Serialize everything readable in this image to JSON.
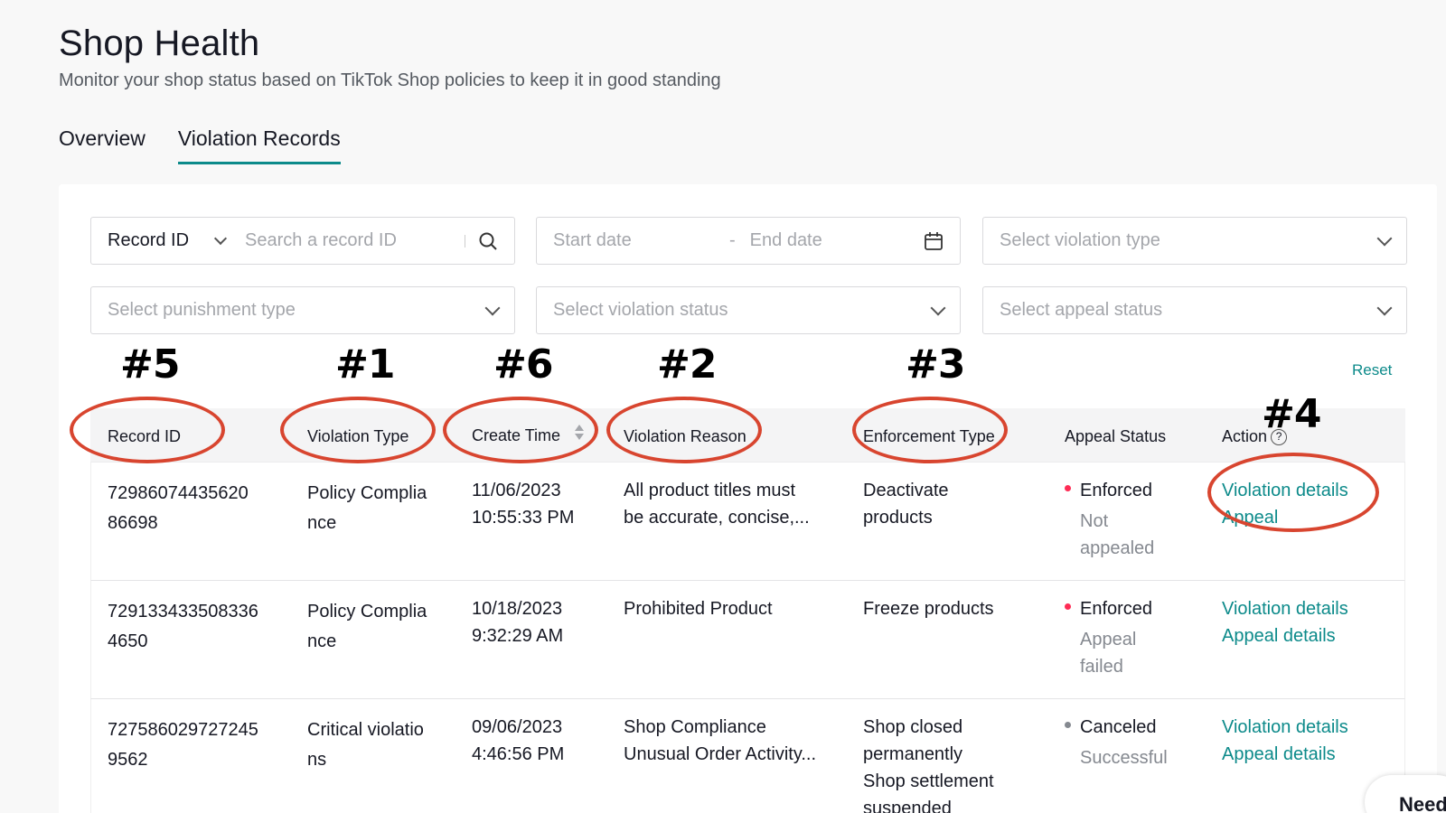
{
  "page": {
    "title": "Shop Health",
    "subtitle": "Monitor your shop status based on TikTok Shop policies to keep it in good standing"
  },
  "tabs": [
    {
      "label": "Overview",
      "active": false
    },
    {
      "label": "Violation Records",
      "active": true
    }
  ],
  "filters": {
    "record_select": "Record ID",
    "record_search_placeholder": "Search a record ID",
    "start_date_placeholder": "Start date",
    "date_separator": "-",
    "end_date_placeholder": "End date",
    "violation_type_placeholder": "Select violation type",
    "punishment_type_placeholder": "Select punishment type",
    "violation_status_placeholder": "Select violation status",
    "appeal_status_placeholder": "Select appeal status",
    "reset_label": "Reset"
  },
  "table": {
    "columns": [
      "Record ID",
      "Violation Type",
      "Create Time",
      "Violation Reason",
      "Enforcement Type",
      "Appeal Status",
      "Action"
    ],
    "rows": [
      {
        "record_id_1": "72986074435620",
        "record_id_2": "86698",
        "type_1": "Policy Complia",
        "type_2": "nce",
        "date": "11/06/2023",
        "time": "10:55:33 PM",
        "reason_1": "All product titles must",
        "reason_2": "be accurate, concise,...",
        "enforcement_1": "Deactivate",
        "enforcement_2": "products",
        "enforcement_3": "",
        "enforcement_4": "",
        "status": "Enforced",
        "status_color": "#fe2c55",
        "appeal_1": "Not",
        "appeal_2": "appealed",
        "action_1": "Violation details",
        "action_2": "Appeal"
      },
      {
        "record_id_1": "729133433508336",
        "record_id_2": "4650",
        "type_1": "Policy Complia",
        "type_2": "nce",
        "date": "10/18/2023",
        "time": "9:32:29 AM",
        "reason_1": "Prohibited Product",
        "reason_2": "",
        "enforcement_1": "Freeze products",
        "enforcement_2": "",
        "enforcement_3": "",
        "enforcement_4": "",
        "status": "Enforced",
        "status_color": "#fe2c55",
        "appeal_1": "Appeal",
        "appeal_2": "failed",
        "action_1": "Violation details",
        "action_2": "Appeal details"
      },
      {
        "record_id_1": "727586029727245",
        "record_id_2": "9562",
        "type_1": "Critical violatio",
        "type_2": "ns",
        "date": "09/06/2023",
        "time": "4:46:56 PM",
        "reason_1": "Shop Compliance",
        "reason_2": "Unusual Order Activity...",
        "enforcement_1": "Shop closed",
        "enforcement_2": "permanently",
        "enforcement_3": "Shop settlement",
        "enforcement_4": "suspended",
        "status": "Canceled",
        "status_color": "#858990",
        "appeal_1": "Successful",
        "appeal_2": "",
        "action_1": "Violation details",
        "action_2": "Appeal details"
      }
    ]
  },
  "annotations": [
    "#5",
    "#1",
    "#6",
    "#2",
    "#3",
    "#4"
  ],
  "annotation_color": "#d8452f",
  "accent_color": "#0c8a8a",
  "help_widget": "Need",
  "icons": [
    "search-icon",
    "calendar-icon",
    "chevron-down-icon",
    "sort-icon",
    "help-icon"
  ]
}
